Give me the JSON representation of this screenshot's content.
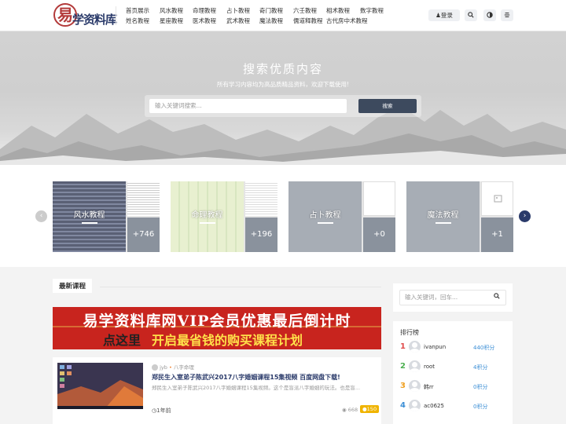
{
  "header": {
    "logo_seal": "易",
    "logo_text": "学资料库",
    "nav": [
      [
        "首页展示",
        "风水教程",
        "命理教程",
        "占卜教程",
        "奇门教程",
        "六壬教程",
        "相术教程",
        "数字教程"
      ],
      [
        "姓名教程",
        "星座教程",
        "医术教程",
        "武术教程",
        "魔法教程",
        "儒道释教程",
        "古代房中术教程"
      ]
    ],
    "login_label": "登录",
    "icons": [
      "search-icon",
      "theme-toggle-icon",
      "menu-icon"
    ]
  },
  "hero": {
    "title": "搜索优质内容",
    "subtitle": "所有学习内容均为高品质精品资料，欢迎下载使用!",
    "search_placeholder": "输入关键词搜索...",
    "search_button": "搜索"
  },
  "categories": [
    {
      "label": "风水教程",
      "count": "+746"
    },
    {
      "label": "命理教程",
      "count": "+196"
    },
    {
      "label": "占卜教程",
      "count": "+0"
    },
    {
      "label": "魔法教程",
      "count": "+1"
    }
  ],
  "main": {
    "section_title": "最新课程",
    "banner": {
      "line1": "易学资料库网VIP会员优惠最后倒计时",
      "line2_dark": "点这里",
      "line2_highlight": "开启最省钱的购买课程计划"
    },
    "post": {
      "author": "jyb",
      "category": "八字命理",
      "title": "郑民生入室弟子陈武兴2017八字婚姻课程15集视频 百度网盘下载!",
      "excerpt": "郑民生入室弟子陈武兴2017八字婚姻课程15集视频。这个是盲派八字婚姻的玩法。也是盲...",
      "time": "1年前",
      "views": "668",
      "points": "150"
    }
  },
  "sidebar": {
    "search_placeholder": "输入关键词，回车...",
    "ranking_title": "排行榜",
    "ranking": [
      {
        "rank": "1",
        "name": "ivanpun",
        "score": "440积分",
        "color": "#e04b4b"
      },
      {
        "rank": "2",
        "name": "root",
        "score": "4积分",
        "color": "#4caf50"
      },
      {
        "rank": "3",
        "name": "韩rr",
        "score": "0积分",
        "color": "#f0a020"
      },
      {
        "rank": "4",
        "name": "ac0625",
        "score": "0积分",
        "color": "#3c8fd6"
      }
    ]
  }
}
